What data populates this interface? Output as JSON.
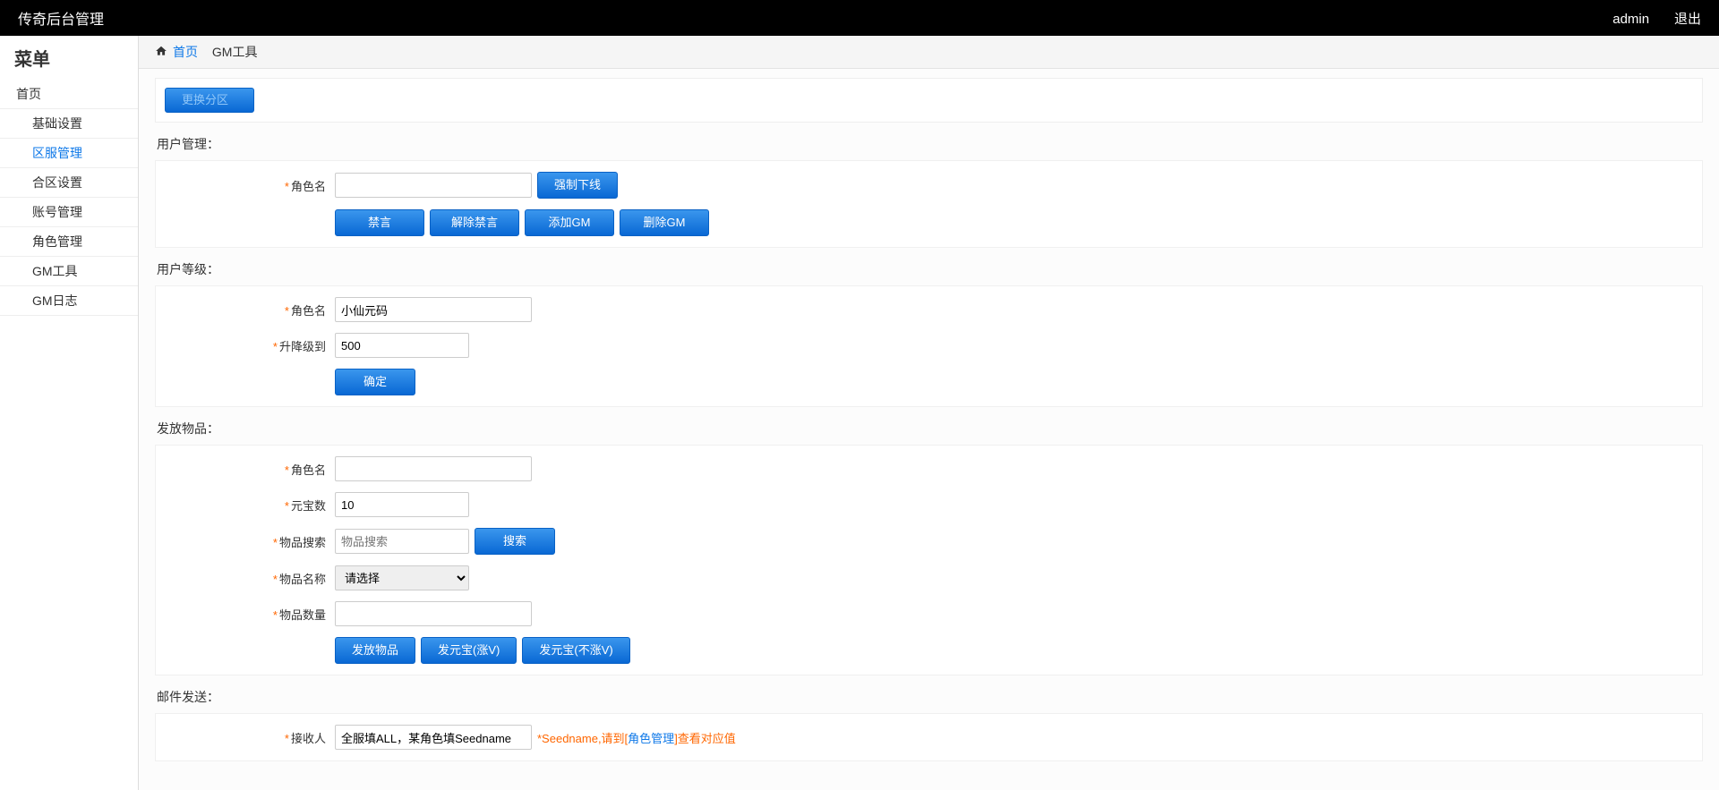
{
  "topbar": {
    "title": "传奇后台管理",
    "user": "admin",
    "logout": "退出"
  },
  "sidebar": {
    "title": "菜单",
    "items": [
      {
        "label": "首页",
        "level": 1,
        "active": false
      },
      {
        "label": "基础设置",
        "level": 2,
        "active": false
      },
      {
        "label": "区服管理",
        "level": 2,
        "active": true
      },
      {
        "label": "合区设置",
        "level": 2,
        "active": false
      },
      {
        "label": "账号管理",
        "level": 2,
        "active": false
      },
      {
        "label": "角色管理",
        "level": 2,
        "active": false
      },
      {
        "label": "GM工具",
        "level": 2,
        "active": false
      },
      {
        "label": "GM日志",
        "level": 2,
        "active": false
      }
    ]
  },
  "breadcrumb": {
    "home": "首页",
    "current": "GM工具"
  },
  "switch_zone_label": "更换分区",
  "sections": {
    "user_mgmt": {
      "title": "用户管理：",
      "role_label": "角色名",
      "role_value": "",
      "btn_force_offline": "强制下线",
      "btn_ban": "禁言",
      "btn_unban": "解除禁言",
      "btn_add_gm": "添加GM",
      "btn_del_gm": "删除GM"
    },
    "user_level": {
      "title": "用户等级：",
      "role_label": "角色名",
      "role_value": "小仙元码",
      "level_label": "升降级到",
      "level_value": "500",
      "btn_confirm": "确定"
    },
    "give_item": {
      "title": "发放物品：",
      "role_label": "角色名",
      "role_value": "",
      "yuanbao_label": "元宝数",
      "yuanbao_value": "10",
      "item_search_label": "物品搜索",
      "item_search_placeholder": "物品搜索",
      "btn_search": "搜索",
      "item_name_label": "物品名称",
      "item_name_select": "请选择",
      "item_qty_label": "物品数量",
      "item_qty_value": "",
      "btn_give_item": "发放物品",
      "btn_give_yb_up": "发元宝(涨V)",
      "btn_give_yb_noup": "发元宝(不涨V)"
    },
    "mail": {
      "title": "邮件发送：",
      "recipient_label": "接收人",
      "recipient_value": "全服填ALL，某角色填Seedname",
      "hint_prefix": "*Seedname,请到[",
      "hint_link": "角色管理",
      "hint_suffix": "]查看对应值"
    }
  }
}
